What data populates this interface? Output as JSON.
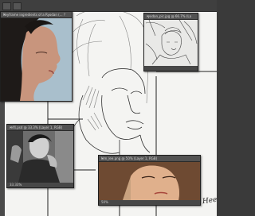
{
  "app": {
    "windows": {
      "ref1_title": "Keyframe ingredients of a Ryodan (... ?",
      "ref2_title": "ryodan_pic.jpg @ 66.7% (Layer 1, RGB/8)",
      "ref3_title": "ref4.psd @ 33.3% (Layer 1, RGB)",
      "ref3_footer": "33.33%",
      "ref4_title": "kim_lee.png @ 50% (Layer 1, RGB)",
      "ref4_footer": "50%"
    },
    "signature": "Hee"
  },
  "colors": {
    "app_chrome": "#3f3f3f",
    "canvas": "#f4f4f2",
    "panel": "#525252"
  }
}
